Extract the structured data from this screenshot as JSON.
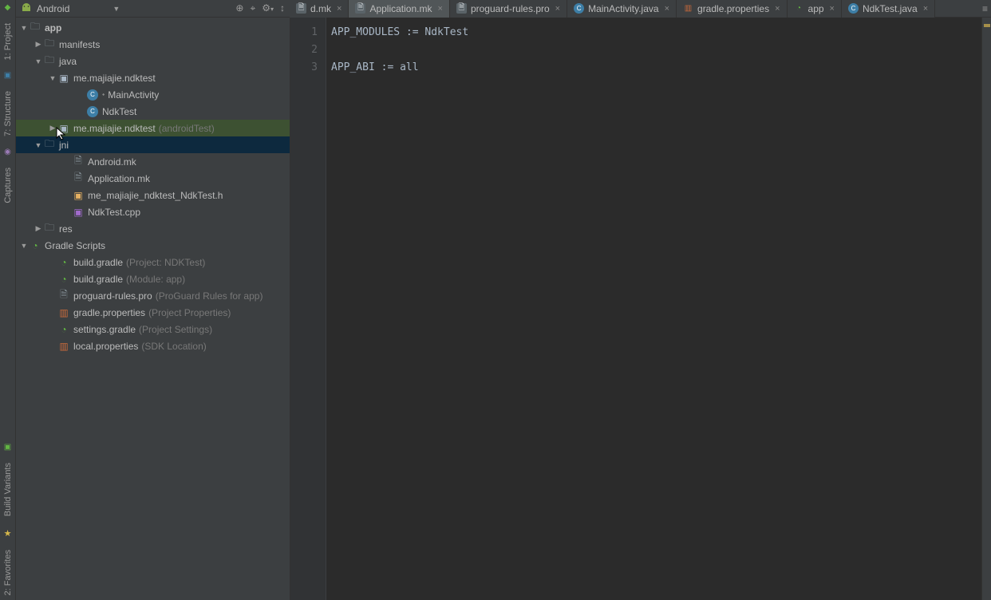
{
  "toolStrip": {
    "labels": [
      "1: Project",
      "7: Structure",
      "Captures",
      "Build Variants",
      "2: Favorites"
    ]
  },
  "topbarLeft": {
    "selector": "Android"
  },
  "tabs": [
    {
      "label": "d.mk",
      "iconClass": "icon-mk"
    },
    {
      "label": "Application.mk",
      "iconClass": "icon-mk",
      "active": true
    },
    {
      "label": "proguard-rules.pro",
      "iconClass": "icon-mk"
    },
    {
      "label": "MainActivity.java",
      "iconClass": "icon-java"
    },
    {
      "label": "gradle.properties",
      "iconClass": "icon-props"
    },
    {
      "label": "app",
      "iconClass": "icon-gradle"
    },
    {
      "label": "NdkTest.java",
      "iconClass": "icon-java"
    }
  ],
  "tree": {
    "app": "app",
    "manifests": "manifests",
    "java": "java",
    "pkg1": "me.majiajie.ndktest",
    "main_activity": "MainActivity",
    "ndk_test": "NdkTest",
    "pkg2": "me.majiajie.ndktest",
    "pkg2_suffix": "(androidTest)",
    "jni": "jni",
    "android_mk": "Android.mk",
    "application_mk": "Application.mk",
    "ndk_h": "me_majiajie_ndktest_NdkTest.h",
    "ndk_cpp": "NdkTest.cpp",
    "res": "res",
    "gradle_scripts": "Gradle Scripts",
    "bg1": "build.gradle",
    "bg1_s": "(Project: NDKTest)",
    "bg2": "build.gradle",
    "bg2_s": "(Module: app)",
    "pg": "proguard-rules.pro",
    "pg_s": "(ProGuard Rules for app)",
    "gp": "gradle.properties",
    "gp_s": "(Project Properties)",
    "sg": "settings.gradle",
    "sg_s": "(Project Settings)",
    "lp": "local.properties",
    "lp_s": "(SDK Location)"
  },
  "editor": {
    "gutterLines": [
      "1",
      "2",
      "3"
    ],
    "lines": [
      "APP_MODULES := NdkTest",
      "",
      "APP_ABI := all"
    ]
  }
}
